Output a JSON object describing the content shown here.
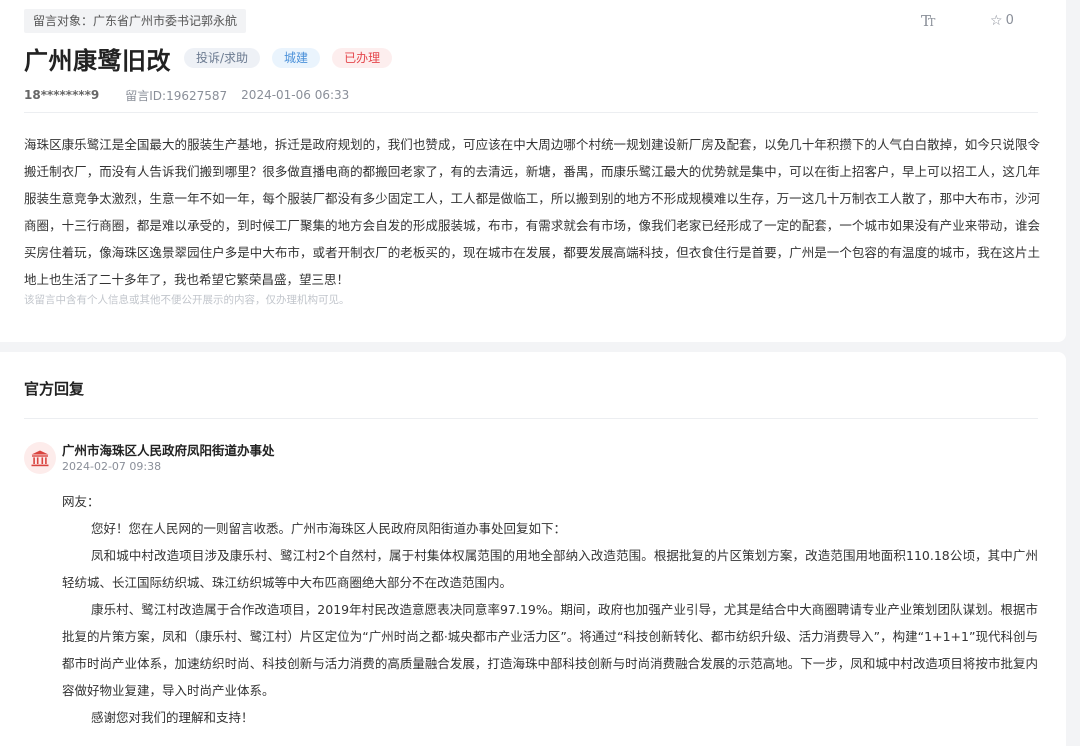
{
  "message": {
    "target_label": "留言对象：",
    "target_name": "广东省广州市委书记郭永航",
    "favorite_count": "0",
    "font_size_icon": "Tт",
    "title": "广州康鹭旧改",
    "tags": {
      "type": "投诉/求助",
      "domain": "城建",
      "status": "已办理"
    },
    "user": "18********9",
    "message_id": "留言ID:19627587",
    "datetime": "2024-01-06 06:33",
    "body": "海珠区康乐鹭江是全国最大的服装生产基地，拆迁是政府规划的，我们也赞成，可应该在中大周边哪个村统一规划建设新厂房及配套，以免几十年积攒下的人气白白散掉，如今只说限令搬迁制衣厂，而没有人告诉我们搬到哪里？很多做直播电商的都搬回老家了，有的去清远，新塘，番禺，而康乐鹭江最大的优势就是集中，可以在街上招客户，早上可以招工人，这几年服装生意竞争太激烈，生意一年不如一年，每个服装厂都没有多少固定工人，工人都是做临工，所以搬到别的地方不形成规模难以生存，万一这几十万制衣工人散了，那中大布市，沙河商圈，十三行商圈，都是难以承受的，到时候工厂聚集的地方会自发的形成服装城，布市，有需求就会有市场，像我们老家已经形成了一定的配套，一个城市如果没有产业来带动，谁会买房住着玩，像海珠区逸景翠园住户多是中大布市，或者开制衣厂的老板买的，现在城市在发展，都要发展高端科技，但衣食住行是首要，广州是一个包容的有温度的城市，我在这片土地上也生活了二十多年了，我也希望它繁荣昌盛，望三思！",
    "privacy_note": "该留言中含有个人信息或其他不便公开展示的内容，仅办理机构可见。"
  },
  "reply": {
    "heading": "官方回复",
    "org_name": "广州市海珠区人民政府凤阳街道办事处",
    "datetime": "2024-02-07 09:38",
    "salutation": "网友：",
    "paragraphs": [
      "您好！您在人民网的一则留言收悉。广州市海珠区人民政府凤阳街道办事处回复如下：",
      "凤和城中村改造项目涉及康乐村、鹭江村2个自然村，属于村集体权属范围的用地全部纳入改造范围。根据批复的片区策划方案，改造范围用地面积110.18公顷，其中广州轻纺城、长江国际纺织城、珠江纺织城等中大布匹商圈绝大部分不在改造范围内。",
      "康乐村、鹭江村改造属于合作改造项目，2019年村民改造意愿表决同意率97.19%。期间，政府也加强产业引导，尤其是结合中大商圈聘请专业产业策划团队谋划。根据市批复的片策方案，凤和（康乐村、鹭江村）片区定位为“广州时尚之都·城央都市产业活力区”。将通过“科技创新转化、都市纺织升级、活力消费导入”，构建“1+1+1”现代科创与都市时尚产业体系，加速纺织时尚、科技创新与活力消费的高质量融合发展，打造海珠中部科技创新与时尚消费融合发展的示范高地。下一步，凤和城中村改造项目将按市批复内容做好物业复建，导入时尚产业体系。",
      "感谢您对我们的理解和支持！"
    ]
  },
  "icons": {
    "favorite": "star-outline-icon",
    "font_size": "text-size-icon",
    "org": "government-building-icon"
  },
  "colors": {
    "status_red": "#e5484d",
    "domain_blue": "#4a90d9",
    "org_icon_red": "#d9443f"
  }
}
